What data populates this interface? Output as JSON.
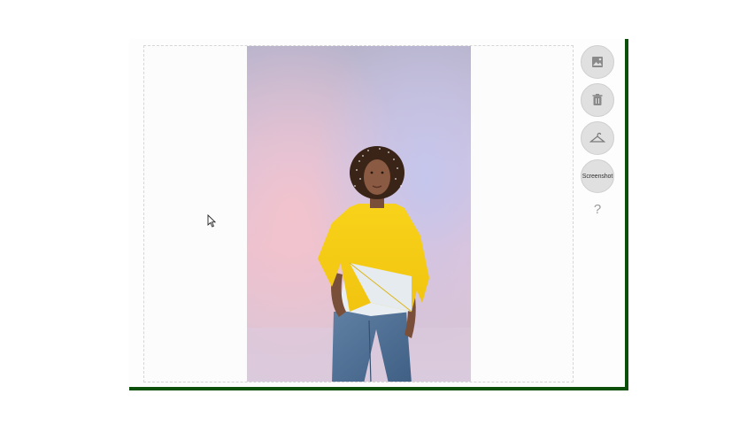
{
  "tools": {
    "image_label": "",
    "delete_label": "",
    "garment_label": "",
    "screenshot_label": "Screenshot",
    "help_label": "?"
  },
  "icons": {
    "image": "image-icon",
    "delete": "trash-icon",
    "garment": "hanger-icon",
    "cursor": "mouse-pointer-icon"
  },
  "colors": {
    "frame_border": "#0b4f0b",
    "button_bg": "#e0e0e0",
    "shirt": "#f7cc17",
    "jeans": "#4f6f93"
  }
}
